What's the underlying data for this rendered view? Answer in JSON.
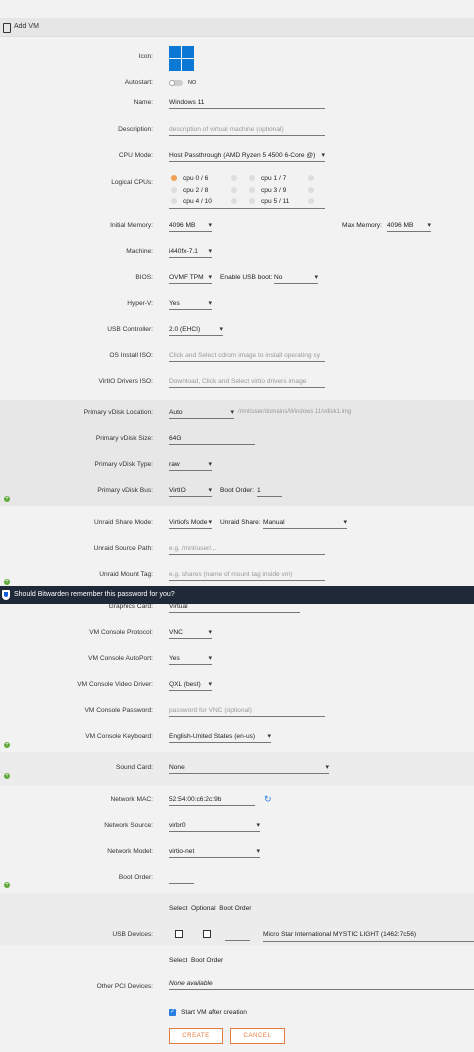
{
  "header": {
    "title": "Add VM"
  },
  "form": {
    "icon_label": "Icon:",
    "autostart_label": "Autostart:",
    "autostart_value": "NO",
    "name_label": "Name:",
    "name_value": "Windows 11",
    "description_label": "Description:",
    "description_placeholder": "description of virtual machine (optional)",
    "cpu_mode_label": "CPU Mode:",
    "cpu_mode_value": "Host Passthrough (AMD Ryzen 5 4500 6-Core @)",
    "logical_cpus_label": "Logical CPUs:",
    "cpus": [
      {
        "label": "cpu 0 / 6",
        "selected": true
      },
      {
        "label": "cpu 1 / 7",
        "selected": false
      },
      {
        "label": "cpu 2 / 8",
        "selected": false
      },
      {
        "label": "cpu 3 / 9",
        "selected": false
      },
      {
        "label": "cpu 4 / 10",
        "selected": false
      },
      {
        "label": "cpu 5 / 11",
        "selected": false
      }
    ],
    "initial_memory_label": "Initial Memory:",
    "initial_memory_value": "4096 MB",
    "max_memory_label": "Max Memory:",
    "max_memory_value": "4096 MB",
    "machine_label": "Machine:",
    "machine_value": "i440fx-7.1",
    "bios_label": "BIOS:",
    "bios_value": "OVMF TPM",
    "usb_boot_label": "Enable USB boot:",
    "usb_boot_value": "No",
    "hyperv_label": "Hyper-V:",
    "hyperv_value": "Yes",
    "usb_controller_label": "USB Controller:",
    "usb_controller_value": "2.0 (EHCI)",
    "os_iso_label": "OS Install ISO:",
    "os_iso_placeholder": "Click and Select cdrom image to install operating sy",
    "virtio_iso_label": "VirtIO Drivers ISO:",
    "virtio_iso_placeholder": "Download, Click and Select virtio drivers image"
  },
  "disk": {
    "location_label": "Primary vDisk Location:",
    "location_value": "Auto",
    "location_path": "/mnt/user/domains/Windows 11/vdisk1.img",
    "size_label": "Primary vDisk Size:",
    "size_value": "64G",
    "type_label": "Primary vDisk Type:",
    "type_value": "raw",
    "bus_label": "Primary vDisk Bus:",
    "bus_value": "VirtIO",
    "boot_order_label": "Boot Order:",
    "boot_order_value": "1"
  },
  "share": {
    "mode_label": "Unraid Share Mode:",
    "mode_value": "Virtiofs Mode",
    "share_label": "Unraid Share:",
    "share_value": "Manual",
    "source_label": "Unraid Source Path:",
    "source_placeholder": "e.g. /mnt/user/...",
    "tag_label": "Unraid Mount Tag:",
    "tag_placeholder": "e.g. shares (name of mount tag inside vm)"
  },
  "bitwarden": {
    "message": "Should Bitwarden remember this password for you?"
  },
  "graphics": {
    "card_label": "Graphics Card:",
    "card_value": "Virtual",
    "protocol_label": "VM Console Protocol:",
    "protocol_value": "VNC",
    "autoport_label": "VM Console AutoPort:",
    "autoport_value": "Yes",
    "video_label": "VM Console Video Driver:",
    "video_value": "QXL (best)",
    "password_label": "VM Console Password:",
    "password_placeholder": "password for VNC (optional)",
    "keyboard_label": "VM Console Keyboard:",
    "keyboard_value": "English-United States (en-us)"
  },
  "sound": {
    "label": "Sound Card:",
    "value": "None"
  },
  "network": {
    "mac_label": "Network MAC:",
    "mac_value": "52:54:00:c6:2c:9b",
    "source_label": "Network Source:",
    "source_value": "virbr0",
    "model_label": "Network Model:",
    "model_value": "virtio-net",
    "boot_label": "Boot Order:"
  },
  "usb": {
    "header": "Select  Optional  Boot Order",
    "label": "USB Devices:",
    "device": "Micro Star International MYSTIC LIGHT (1462:7c56)"
  },
  "pci": {
    "header": "Select  Boot Order",
    "label": "Other PCI Devices:",
    "value": "None available"
  },
  "actions": {
    "start_after": "Start VM after creation",
    "create": "CREATE",
    "cancel": "CANCEL"
  },
  "colors": {
    "accent": "#e67a3a",
    "bitwarden_bar": "#1f2937",
    "windows_blue": "#0a78d4"
  }
}
